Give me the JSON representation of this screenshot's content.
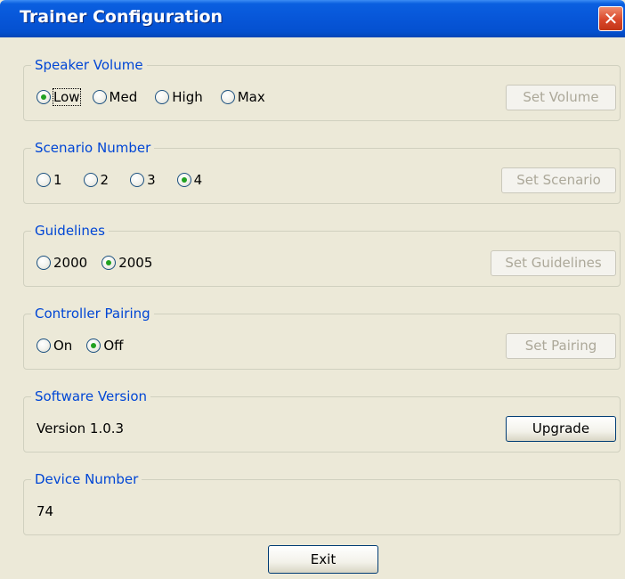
{
  "window": {
    "title": "Trainer Configuration",
    "close_glyph": "✕",
    "colors": {
      "title_bar": "#0756d8",
      "group_label": "#0046d5",
      "body": "#ece9d8",
      "radio_check": "#21a121"
    }
  },
  "speaker_volume": {
    "label": "Speaker Volume",
    "options": [
      "Low",
      "Med",
      "High",
      "Max"
    ],
    "selected": "Low",
    "button": "Set Volume"
  },
  "scenario_number": {
    "label": "Scenario Number",
    "options": [
      "1",
      "2",
      "3",
      "4"
    ],
    "selected": "4",
    "button": "Set Scenario"
  },
  "guidelines": {
    "label": "Guidelines",
    "options": [
      "2000",
      "2005"
    ],
    "selected": "2005",
    "button": "Set Guidelines"
  },
  "controller_pairing": {
    "label": "Controller Pairing",
    "options": [
      "On",
      "Off"
    ],
    "selected": "Off",
    "button": "Set Pairing"
  },
  "software_version": {
    "label": "Software Version",
    "value": "Version 1.0.3",
    "button": "Upgrade"
  },
  "device_number": {
    "label": "Device Number",
    "value": "74"
  },
  "footer": {
    "exit": "Exit"
  }
}
